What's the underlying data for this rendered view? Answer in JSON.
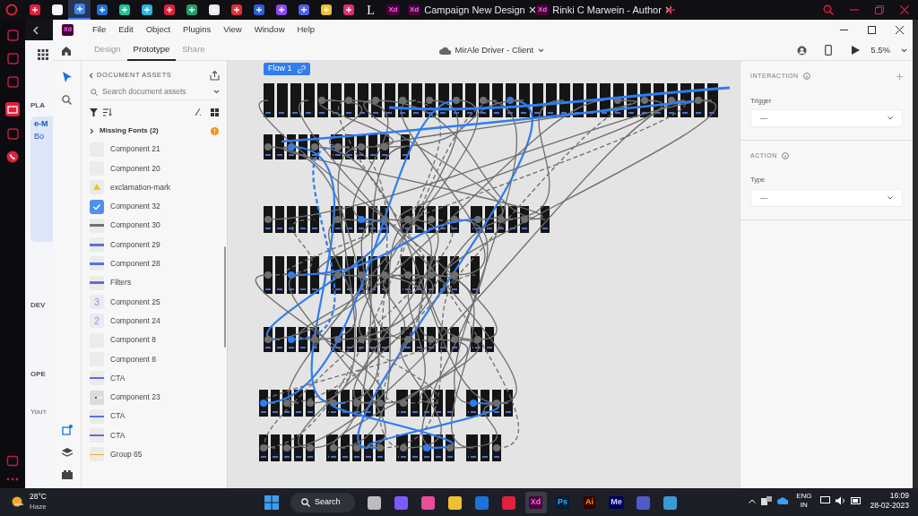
{
  "browser": {
    "pinned_tabs": [
      {
        "selected": false
      },
      {
        "selected": false
      },
      {
        "selected": true
      },
      {
        "selected": false
      },
      {
        "selected": false
      },
      {
        "selected": false
      },
      {
        "selected": false
      },
      {
        "selected": false
      },
      {
        "selected": false
      },
      {
        "selected": false
      },
      {
        "selected": false
      },
      {
        "selected": false
      },
      {
        "selected": false
      },
      {
        "selected": false
      },
      {
        "selected": false
      },
      {
        "selected": false,
        "label": "L"
      },
      {
        "selected": false,
        "label": "Xd"
      }
    ],
    "tabs": [
      {
        "badge": "Xd",
        "label": "Campaign New Design"
      },
      {
        "badge": "Xd",
        "label": "Rinki C Marwein - Author"
      }
    ]
  },
  "background_page": {
    "texts": [
      "PLA",
      "e-M",
      "Bo",
      "DEV",
      "OPE",
      "You'r"
    ]
  },
  "app": {
    "logo": "Xd",
    "menu": [
      "File",
      "Edit",
      "Object",
      "Plugins",
      "View",
      "Window",
      "Help"
    ],
    "mode_tabs": [
      {
        "label": "Design",
        "selected": false
      },
      {
        "label": "Prototype",
        "selected": true
      },
      {
        "label": "Share",
        "selected": false
      }
    ],
    "document_title": "MirAle Driver - Client",
    "zoom": "5.5%",
    "assets": {
      "title": "DOCUMENT ASSETS",
      "search": {
        "placeholder": "Search document assets"
      },
      "missing_fonts": "Missing Fonts (2)",
      "items": [
        {
          "kind": "blank",
          "label": "Component 21"
        },
        {
          "kind": "blank",
          "label": "Component 20"
        },
        {
          "kind": "warning",
          "label": "exclamation-mark"
        },
        {
          "kind": "check",
          "label": "Component 32"
        },
        {
          "kind": "bar",
          "color": "#707070",
          "label": "Component 30"
        },
        {
          "kind": "bar",
          "color": "#5b6fe0",
          "label": "Component 29"
        },
        {
          "kind": "bar",
          "color": "#5b6fe0",
          "label": "Component 28"
        },
        {
          "kind": "bar",
          "color": "#5b6fe0",
          "label": "Filters"
        },
        {
          "kind": "number",
          "thumb": "3",
          "label": "Component 25"
        },
        {
          "kind": "number",
          "thumb": "2",
          "label": "Component 24"
        },
        {
          "kind": "blank",
          "label": "Component 8"
        },
        {
          "kind": "blank",
          "label": "Component 8"
        },
        {
          "kind": "line",
          "color": "#5b6fe0",
          "label": "CTA"
        },
        {
          "kind": "dot",
          "label": "Component 23"
        },
        {
          "kind": "line",
          "color": "#5b6fe0",
          "label": "CTA"
        },
        {
          "kind": "line",
          "color": "#5b6fe0",
          "label": "CTA"
        },
        {
          "kind": "line",
          "color": "#e0b020",
          "label": "Group 65"
        }
      ]
    },
    "canvas": {
      "flow": "Flow 1"
    },
    "inspector": {
      "sections": [
        {
          "title": "INTERACTION",
          "field_label": "Trigger",
          "value": "—",
          "add": true
        },
        {
          "title": "ACTION",
          "field_label": "Type",
          "value": "—",
          "add": false
        }
      ]
    }
  },
  "taskbar": {
    "weather": {
      "temperature": "28°C",
      "condition": "Haze"
    },
    "search": "Search",
    "apps": [
      {
        "selected": false
      },
      {
        "selected": false
      },
      {
        "selected": false
      },
      {
        "selected": false
      },
      {
        "selected": false
      },
      {
        "selected": false
      },
      {
        "label": "Xd",
        "selected": true
      },
      {
        "label": "Ps",
        "selected": false
      },
      {
        "label": "Ai",
        "selected": false
      },
      {
        "label": "Me",
        "selected": false
      },
      {
        "selected": false
      },
      {
        "selected": false
      }
    ],
    "language": [
      "ENG",
      "IN"
    ],
    "time": "16:09",
    "date": "28-02-2023"
  }
}
